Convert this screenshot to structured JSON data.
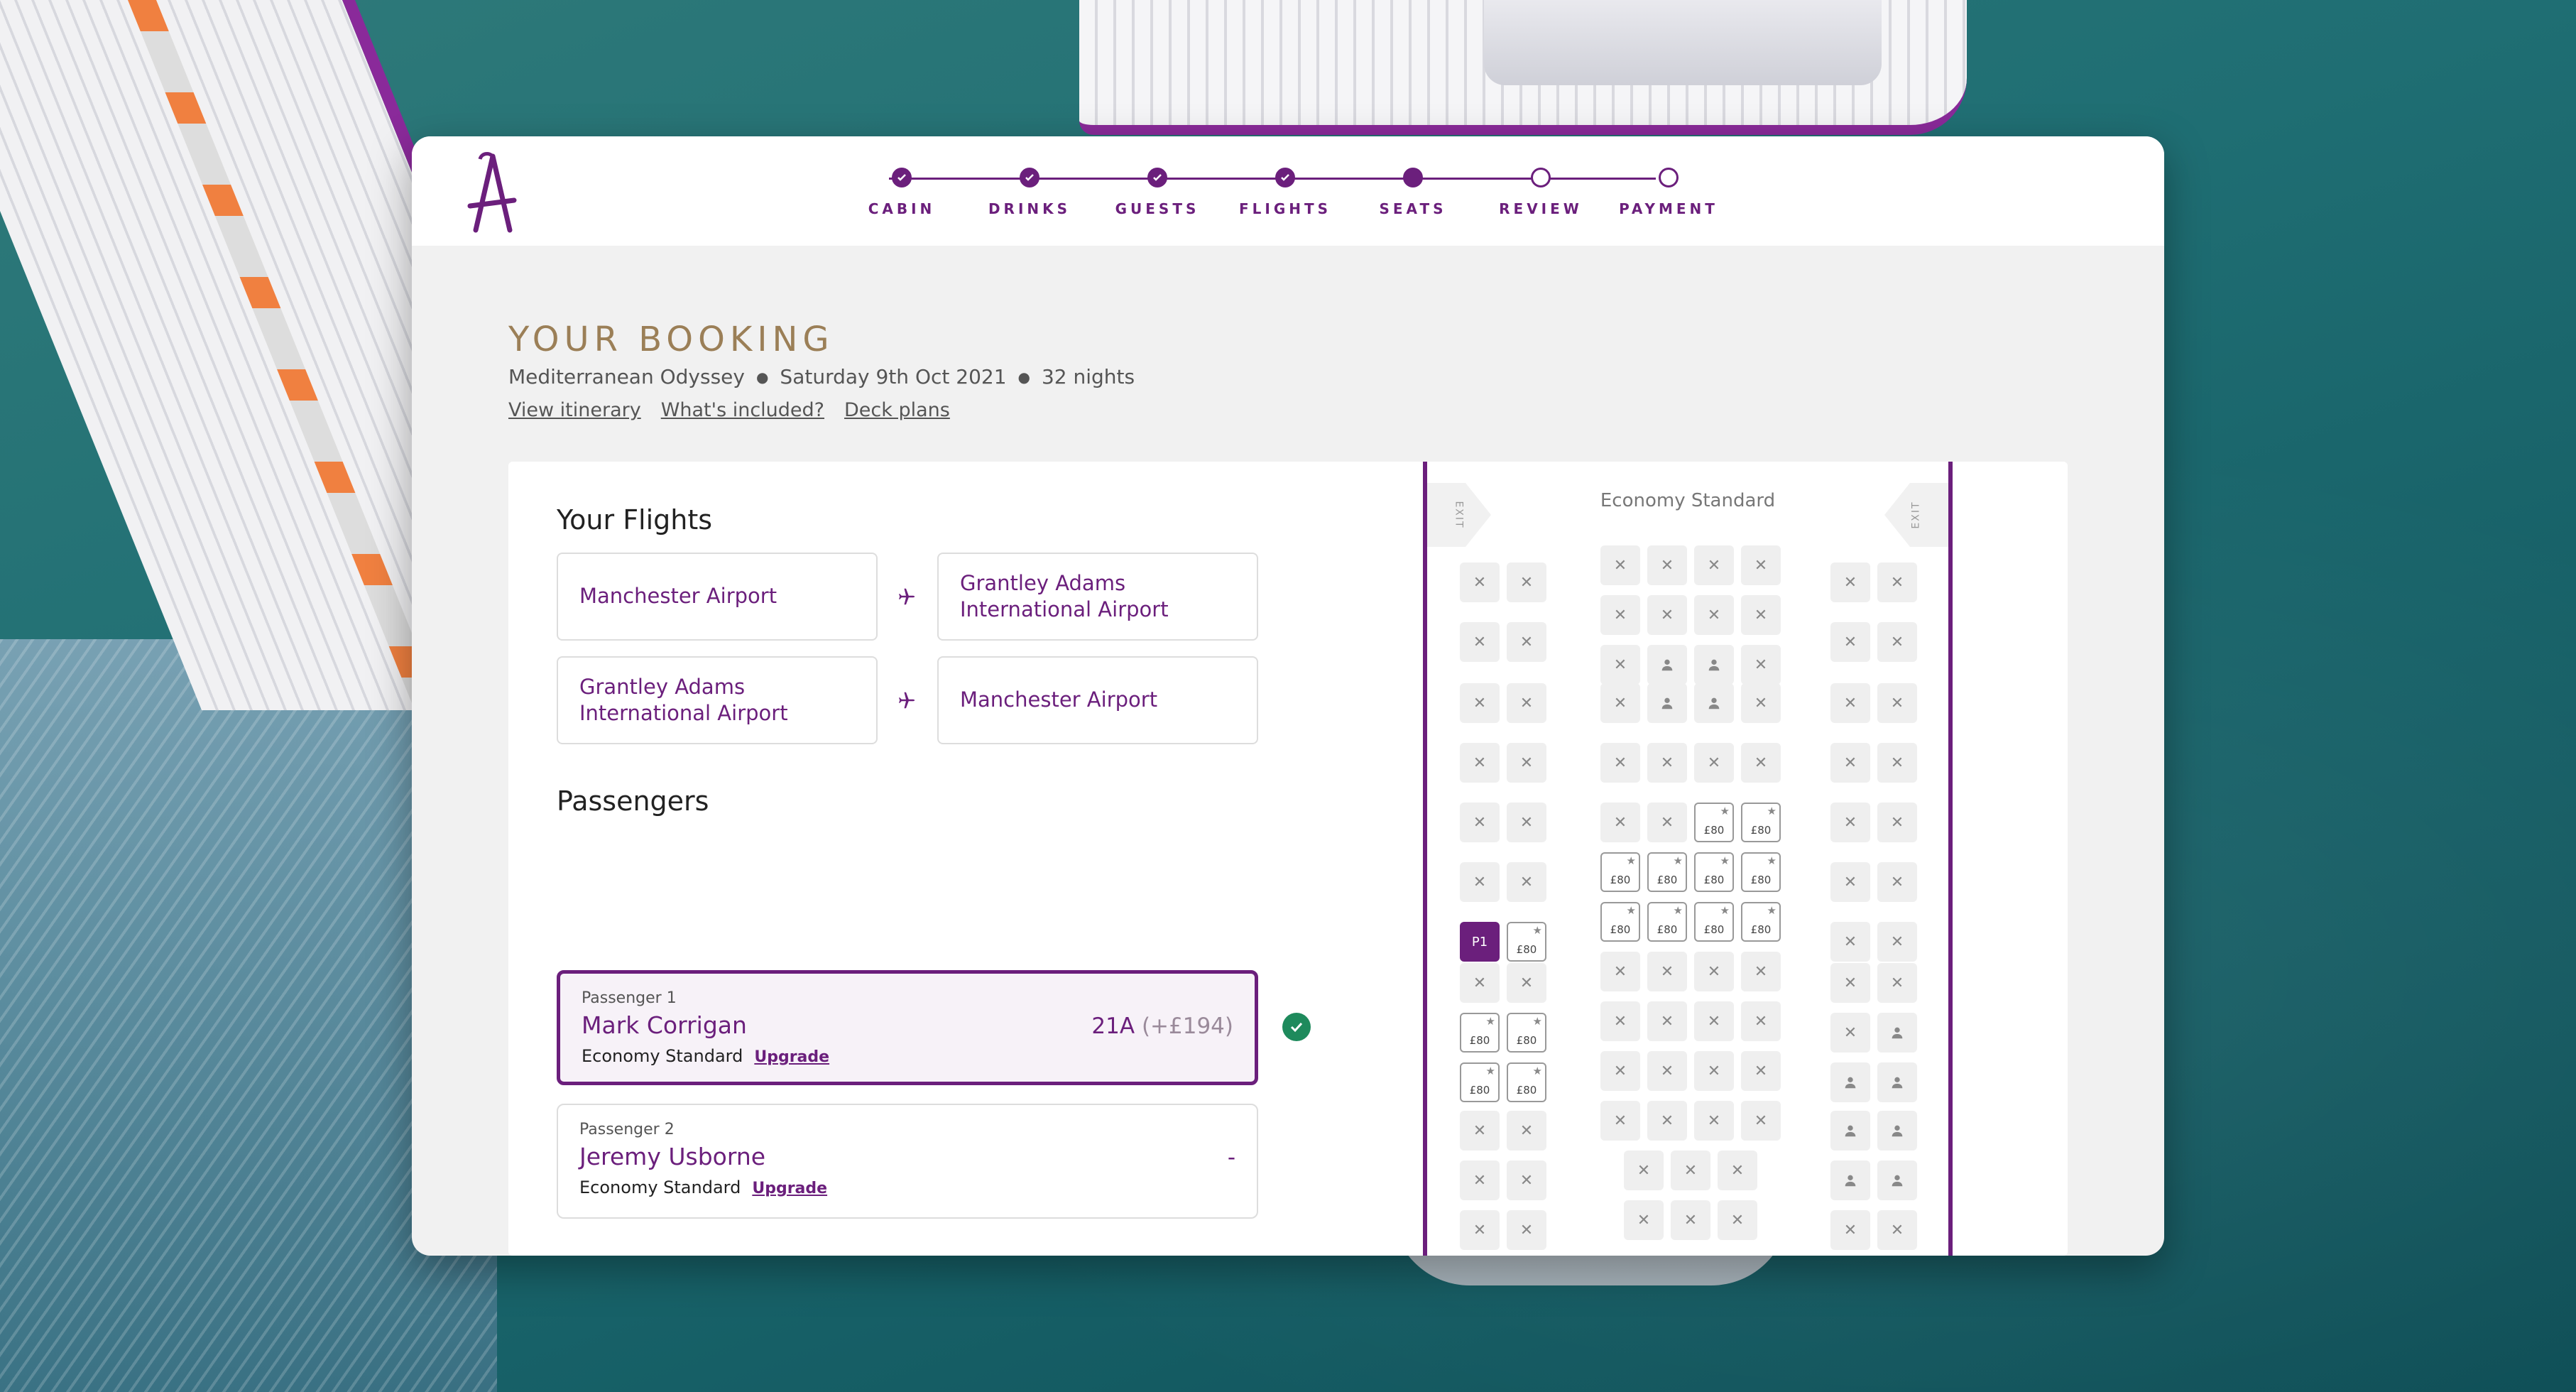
{
  "progress": {
    "steps": [
      {
        "label": "CABIN",
        "state": "done"
      },
      {
        "label": "DRINKS",
        "state": "done"
      },
      {
        "label": "GUESTS",
        "state": "done"
      },
      {
        "label": "FLIGHTS",
        "state": "done"
      },
      {
        "label": "SEATS",
        "state": "current"
      },
      {
        "label": "REVIEW",
        "state": "todo"
      },
      {
        "label": "PAYMENT",
        "state": "todo"
      }
    ]
  },
  "booking": {
    "title": "YOUR BOOKING",
    "cruise": "Mediterranean Odyssey",
    "date": "Saturday 9th Oct 2021",
    "nights": "32 nights",
    "links": [
      "View itinerary",
      "What's included?",
      "Deck plans"
    ]
  },
  "flights": {
    "title": "Your Flights",
    "legs": [
      {
        "from": "Manchester Airport",
        "to": "Grantley Adams International Airport"
      },
      {
        "from": "Grantley Adams International Airport",
        "to": "Manchester Airport"
      }
    ]
  },
  "passengers": {
    "title": "Passengers",
    "list": [
      {
        "num": "Passenger 1",
        "name": "Mark Corrigan",
        "class": "Economy Standard",
        "upgrade": "Upgrade",
        "seat": "21A",
        "price": "(+£194)"
      },
      {
        "num": "Passenger 2",
        "name": "Jeremy Usborne",
        "class": "Economy Standard",
        "upgrade": "Upgrade",
        "seat": "-",
        "price": ""
      }
    ]
  },
  "seatmap": {
    "label": "Economy Standard",
    "exit_label": "EXIT",
    "price_label": "£80",
    "selected_label": "P1"
  },
  "colors": {
    "brand": "#6b1f7c",
    "gold": "#9b7f57",
    "success": "#1e8a5c"
  }
}
